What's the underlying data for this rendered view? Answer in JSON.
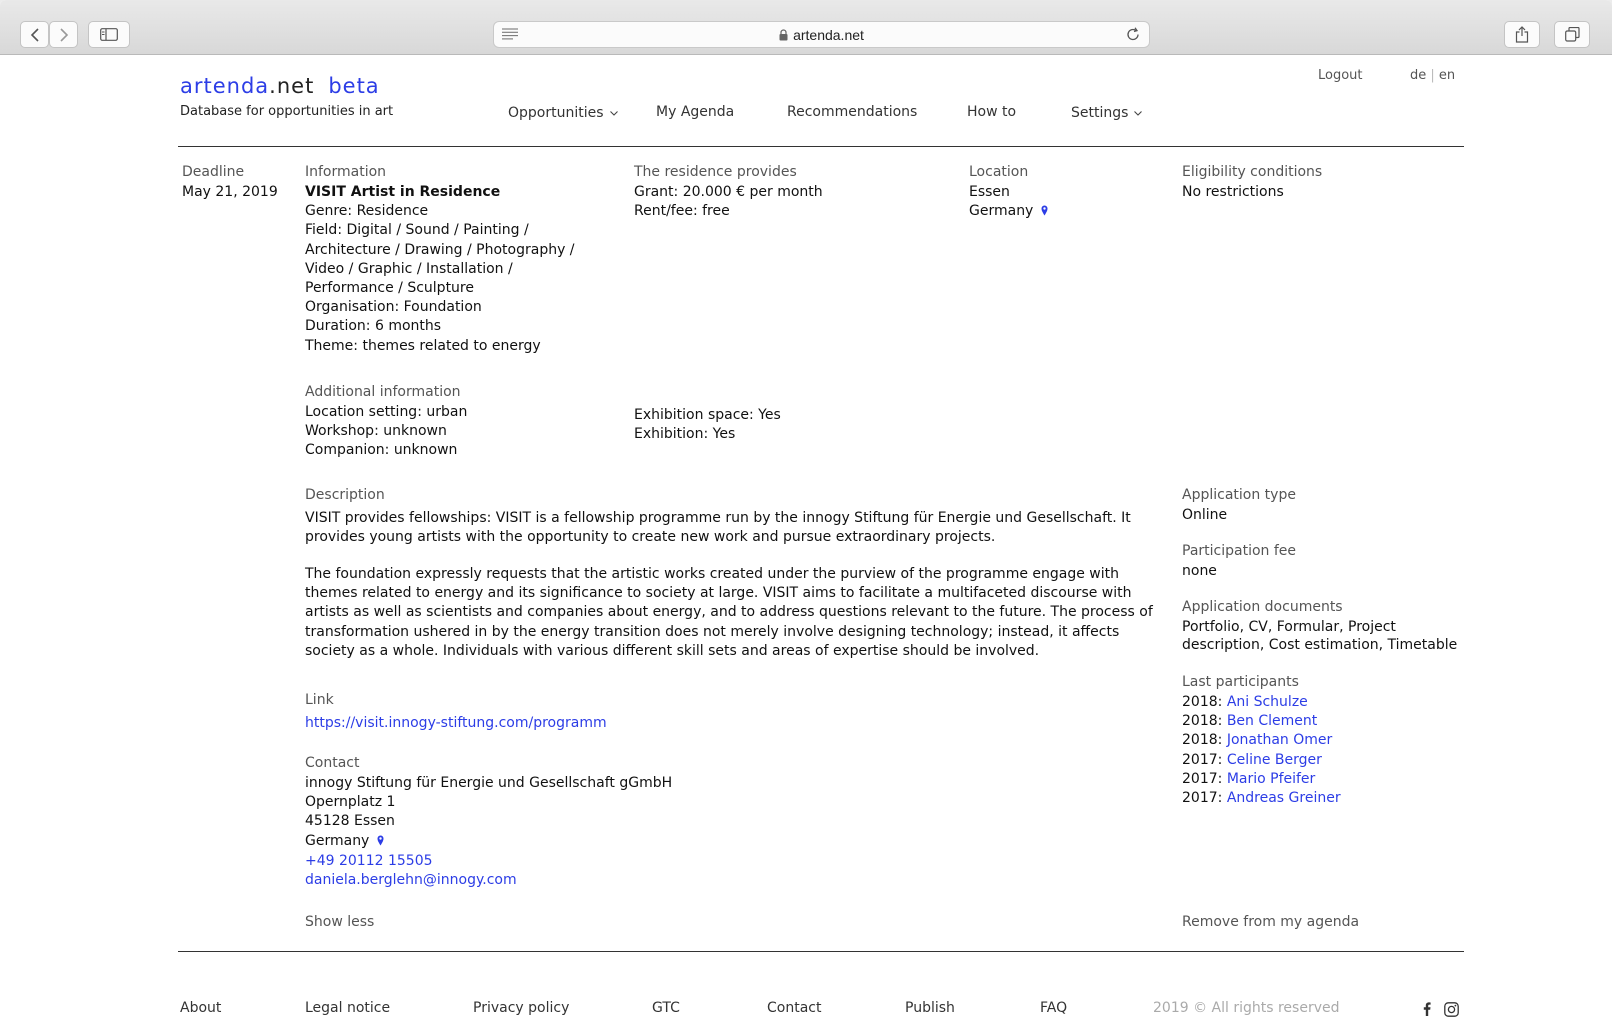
{
  "browser": {
    "url": "artenda.net"
  },
  "site": {
    "logo_main": "artenda",
    "logo_tld": ".net",
    "logo_beta": "beta",
    "tagline": "Database for opportunities in art"
  },
  "nav": {
    "opportunities": "Opportunities",
    "my_agenda": "My Agenda",
    "recommendations": "Recommendations",
    "how_to": "How to",
    "settings": "Settings"
  },
  "top_links": {
    "logout": "Logout",
    "lang_de": "de",
    "lang_sep": "|",
    "lang_en": "en"
  },
  "entry": {
    "deadline_label": "Deadline",
    "deadline_value": "May 21, 2019",
    "information_label": "Information",
    "title": "VISIT Artist in Residence",
    "info_lines": [
      "Genre: Residence",
      "Field: Digital / Sound / Painting /",
      "Architecture / Drawing / Photography /",
      "Video / Graphic / Installation /",
      "Performance / Sculpture",
      "Organisation: Foundation",
      "Duration: 6 months",
      "Theme: themes related to energy"
    ],
    "provides_label": "The residence provides",
    "provides_lines": [
      "Grant: 20.000 € per month",
      "Rent/fee: free"
    ],
    "location_label": "Location",
    "location_city": "Essen",
    "location_country": "Germany",
    "eligibility_label": "Eligibility conditions",
    "eligibility_value": "No restrictions",
    "additional_label": "Additional information",
    "additional_left": [
      "Location setting: urban",
      "Workshop: unknown",
      "Companion: unknown"
    ],
    "additional_right": [
      "Exhibition space: Yes",
      "Exhibition: Yes"
    ],
    "description_label": "Description",
    "description_p1": "VISIT provides fellowships: VISIT is a fellowship programme run by the innogy Stiftung für Energie und Gesellschaft. It provides young artists with the opportunity to create new work and pursue extraordinary projects.",
    "description_p2": "The foundation expressly requests that the artistic works created under the purview of the programme engage with themes related to energy and its significance to society at large. VISIT aims to facilitate a multifaceted discourse with artists as well as scientists and companies about energy, and to address questions relevant to the future. The process of transformation ushered in by the energy transition does not merely involve designing technology; instead, it affects society as a whole. Individuals with various different skill sets and areas of expertise should be involved.",
    "link_label": "Link",
    "link_url": "https://visit.innogy-stiftung.com/programm",
    "contact_label": "Contact",
    "contact_org": "innogy Stiftung für Energie und Gesellschaft gGmbH",
    "contact_street": "Opernplatz 1",
    "contact_city": "45128 Essen",
    "contact_country": "Germany",
    "contact_phone": "+49 20112 15505",
    "contact_email": "daniela.berglehn@innogy.com",
    "show_less": "Show less",
    "application_type_label": "Application type",
    "application_type_value": "Online",
    "participation_fee_label": "Participation fee",
    "participation_fee_value": "none",
    "application_docs_label": "Application documents",
    "application_docs_lines": [
      "Portfolio, CV, Formular, Project",
      "description, Cost estimation, Timetable"
    ],
    "last_participants_label": "Last participants",
    "participants": [
      {
        "year": "2018:",
        "name": "Ani Schulze"
      },
      {
        "year": "2018:",
        "name": "Ben Clement"
      },
      {
        "year": "2018:",
        "name": "Jonathan Omer"
      },
      {
        "year": "2017:",
        "name": "Celine Berger"
      },
      {
        "year": "2017:",
        "name": "Mario Pfeifer"
      },
      {
        "year": "2017:",
        "name": "Andreas Greiner"
      }
    ],
    "remove_agenda": "Remove from my agenda"
  },
  "footer": {
    "about": "About",
    "legal": "Legal notice",
    "privacy": "Privacy policy",
    "gtc": "GTC",
    "contact": "Contact",
    "publish": "Publish",
    "faq": "FAQ",
    "copyright": "2019 © All rights reserved"
  },
  "colors": {
    "accent": "#2c3de6",
    "text": "#111111",
    "label": "#555555"
  },
  "icons": [
    "chevron-left-icon",
    "chevron-right-icon",
    "sidebar-icon",
    "reader-icon",
    "lock-icon",
    "reload-icon",
    "share-icon",
    "tabs-icon",
    "chevron-down-icon",
    "map-pin-icon",
    "facebook-icon",
    "instagram-icon"
  ]
}
